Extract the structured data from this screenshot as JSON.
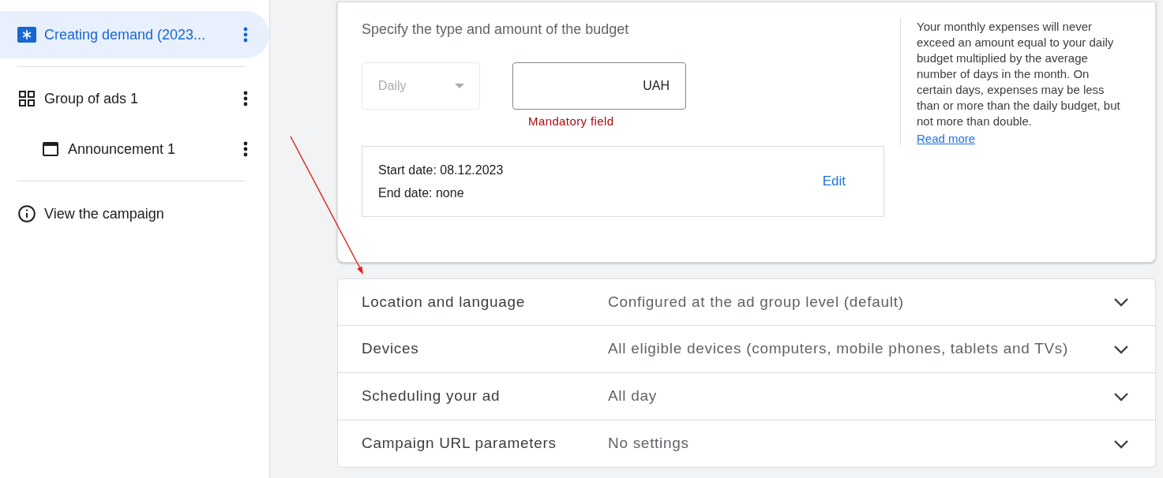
{
  "sidebar": {
    "sections": [
      {
        "items": [
          {
            "kind": "campaign",
            "label": "Creating demand (2023...",
            "selected": true
          }
        ]
      },
      {
        "items": [
          {
            "kind": "ad_group",
            "label": "Group of ads 1",
            "selected": false,
            "children": [
              {
                "kind": "ad",
                "label": "Announcement 1",
                "selected": false
              }
            ]
          }
        ]
      },
      {
        "items": [
          {
            "kind": "link",
            "label": "View the campaign",
            "selected": false
          }
        ]
      }
    ]
  },
  "budget": {
    "heading": "Specify the type and amount of the budget",
    "type_select": {
      "value": "Daily",
      "disabled": true
    },
    "amount_field": {
      "suffix": "UAH",
      "error": "Mandatory field"
    },
    "dates": {
      "start": "Start date: 08.12.2023",
      "end": "End date: none",
      "action": "Edit"
    },
    "help": {
      "text": "Your monthly expenses will never exceed an amount equal to your daily budget multiplied by the average number of days in the month. On certain days, expenses may be less than or more than the daily budget, but not more than double.",
      "link": "Read more"
    }
  },
  "sections": [
    {
      "title": "Location and language",
      "value": "Configured at the ad group level (default)",
      "expanded": false
    },
    {
      "title": "Devices",
      "value": "All eligible devices (computers, mobile phones, tablets and TVs)",
      "expanded": false
    },
    {
      "title": "Scheduling your ad",
      "value": "All day",
      "expanded": false
    },
    {
      "title": "Campaign URL parameters",
      "value": "No settings",
      "expanded": false
    }
  ]
}
